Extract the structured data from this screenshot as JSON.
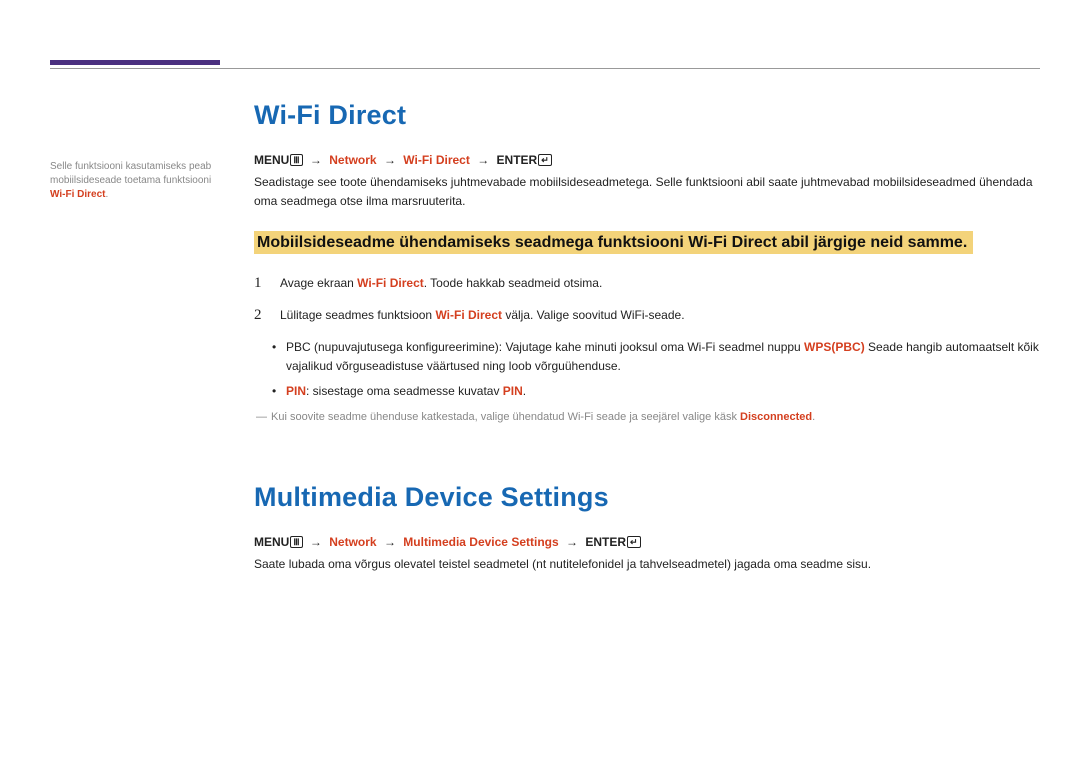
{
  "side_note": {
    "line1": "Selle funktsiooni kasutamiseks peab",
    "line2": "mobiilsideseade toetama funktsiooni",
    "keyword": "Wi-Fi Direct",
    "period": "."
  },
  "section1": {
    "title": "Wi-Fi Direct",
    "breadcrumb": {
      "menu": "MENU",
      "menu_icon": "Ⅲ",
      "arrow": "→",
      "p1": "Network",
      "p2": "Wi-Fi Direct",
      "enter": "ENTER",
      "enter_icon": "↵"
    },
    "intro": "Seadistage see toote ühendamiseks juhtmevabade mobiilsideseadmetega. Selle funktsiooni abil saate juhtmevabad mobiilsideseadmed ühendada oma seadmega otse ilma marsruuterita.",
    "highlight": "Mobiilsideseadme ühendamiseks seadmega funktsiooni Wi-Fi Direct abil järgige neid samme.",
    "step1": {
      "pre": "Avage ekraan ",
      "kw": "Wi-Fi Direct",
      "post": ". Toode hakkab seadmeid otsima."
    },
    "step2": {
      "pre": "Lülitage seadmes funktsioon ",
      "kw": "Wi-Fi Direct",
      "post": " välja. Valige soovitud WiFi-seade."
    },
    "bullet1": {
      "pre": "PBC (nupuvajutusega konfigureerimine): Vajutage kahe minuti jooksul oma Wi-Fi seadmel nuppu ",
      "kw": "WPS(PBC)",
      "post": " Seade hangib automaatselt kõik vajalikud võrguseadistuse väärtused ning loob võrguühenduse."
    },
    "bullet2": {
      "kw1": "PIN",
      "mid": ": sisestage oma seadmesse kuvatav ",
      "kw2": "PIN",
      "period": "."
    },
    "note": {
      "pre": "Kui soovite seadme ühenduse katkestada, valige ühendatud Wi-Fi seade ja seejärel valige käsk ",
      "kw": "Disconnected",
      "post": "."
    }
  },
  "section2": {
    "title": "Multimedia Device Settings",
    "breadcrumb": {
      "menu": "MENU",
      "menu_icon": "Ⅲ",
      "arrow": "→",
      "p1": "Network",
      "p2": "Multimedia Device Settings",
      "enter": "ENTER",
      "enter_icon": "↵"
    },
    "body": "Saate lubada oma võrgus olevatel teistel seadmetel (nt nutitelefonidel ja tahvelseadmetel) jagada oma seadme sisu."
  }
}
